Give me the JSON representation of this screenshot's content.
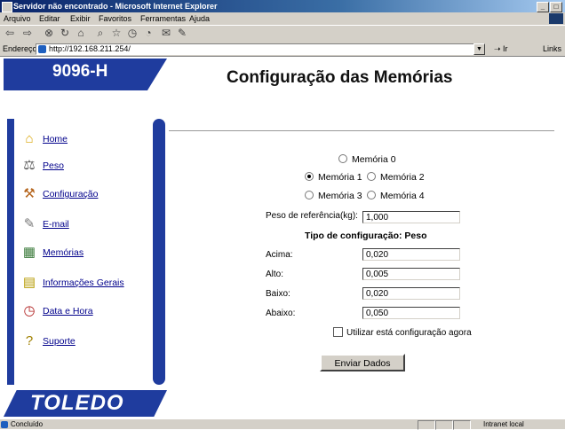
{
  "window": {
    "title": "Servidor não encontrado - Microsoft Internet Explorer",
    "controls": [
      "_",
      "□"
    ]
  },
  "menu": [
    "Arquivo",
    "Editar",
    "Exibir",
    "Favoritos",
    "Ferramentas",
    "Ajuda"
  ],
  "address": {
    "label": "Endereço",
    "url": "http://192.168.211.254/",
    "go_label": "Ir",
    "links_label": "Links"
  },
  "sidebar": {
    "model": "9096-H",
    "items": [
      {
        "label": "Home",
        "icon": "house-icon"
      },
      {
        "label": "Peso",
        "icon": "scale-icon"
      },
      {
        "label": "Configuração",
        "icon": "tools-icon"
      },
      {
        "label": "E-mail",
        "icon": "pen-icon"
      },
      {
        "label": "Memórias",
        "icon": "memory-icon"
      },
      {
        "label": "Informações Gerais",
        "icon": "document-icon"
      },
      {
        "label": "Data e Hora",
        "icon": "clock-icon"
      },
      {
        "label": "Suporte",
        "icon": "question-icon"
      }
    ],
    "brand": "TOLEDO"
  },
  "main": {
    "title": "Configuração das Memórias",
    "memories": [
      {
        "label": "Memória 0",
        "selected": false
      },
      {
        "label": "Memória 1",
        "selected": true
      },
      {
        "label": "Memória 2",
        "selected": false
      },
      {
        "label": "Memória 3",
        "selected": false
      },
      {
        "label": "Memória 4",
        "selected": false
      }
    ],
    "reference_weight": {
      "label": "Peso de referência(kg):",
      "value": "1,000"
    },
    "config_type": "Tipo de configuração: Peso",
    "fields": [
      {
        "label": "Acima:",
        "value": "0,020"
      },
      {
        "label": "Alto:",
        "value": "0,005"
      },
      {
        "label": "Baixo:",
        "value": "0,020"
      },
      {
        "label": "Abaixo:",
        "value": "0,050"
      }
    ],
    "use_now_label": "Utilizar está configuração agora",
    "submit_label": "Enviar Dados"
  },
  "status": {
    "text": "Concluído",
    "zone": "Intranet local"
  }
}
